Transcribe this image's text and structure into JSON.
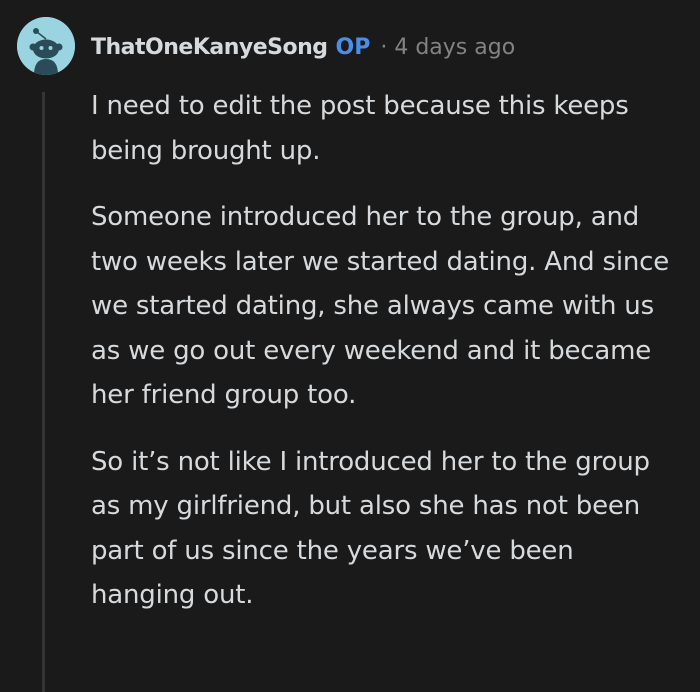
{
  "comment": {
    "username": "ThatOneKanyeSong",
    "op_badge": "OP",
    "separator": "·",
    "timestamp": "4 days ago",
    "avatar_icon": "snoo-avatar-icon",
    "paragraphs": [
      "I need to edit the post because this keeps being brought up.",
      "Someone introduced her to the group, and two weeks later we started dating. And since we started dating, she always came with us as we go out every weekend and it became her friend group too.",
      "So it’s not like I introduced her to the group as my girlfriend, but also she has not been part of us since the years we’ve been hanging out."
    ]
  },
  "colors": {
    "background": "#1a1a1b",
    "text": "#d7dadc",
    "op_accent": "#4a8fe7",
    "meta": "#818384",
    "avatar_bg": "#9ad4e0"
  }
}
